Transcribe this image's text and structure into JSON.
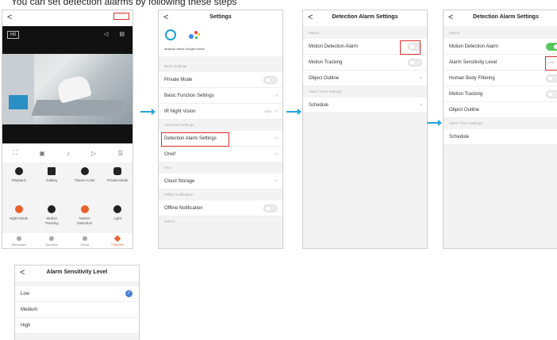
{
  "heading": "You can set detection alarms by following these steps",
  "phone1": {
    "back": "<",
    "more": "···",
    "hd": "HD",
    "features": [
      {
        "label": "Playback",
        "icon": "play-icon"
      },
      {
        "label": "Gallery",
        "icon": "gallery-icon"
      },
      {
        "label": "Theme Color",
        "icon": "palette-icon"
      },
      {
        "label": "Private Mode",
        "icon": "private-mode-icon"
      },
      {
        "label": "Night Mode",
        "icon": "night-mode-icon"
      },
      {
        "label": "Motion Tracking",
        "icon": "motion-tracking-icon"
      },
      {
        "label": "Motion Detection",
        "icon": "motion-detection-icon"
      },
      {
        "label": "Light",
        "icon": "light-icon"
      }
    ],
    "tabs": [
      {
        "label": "Messages",
        "icon": "bell-icon"
      },
      {
        "label": "Direction",
        "icon": "direction-icon"
      },
      {
        "label": "Cloud",
        "icon": "cloud-icon"
      },
      {
        "label": "Features",
        "icon": "features-icon"
      }
    ]
  },
  "phone2": {
    "title": "Settings",
    "brand_amazon": "amazon alexa",
    "brand_google": "Google Home",
    "sections": {
      "basic": "Basic Settings",
      "advanced": "Advanced Settings",
      "vas": "VAS",
      "offline": "Offline Notification",
      "others": "Others"
    },
    "rows": {
      "private_mode": "Private Mode",
      "basic_function": "Basic Function Settings",
      "ir_night": "IR Night Vision",
      "ir_value": "Auto",
      "detection_alarm": "Detection Alarm Settings",
      "onvif": "Onvif",
      "cloud_storage": "Cloud Storage",
      "offline_notification": "Offline Notification"
    }
  },
  "phone3": {
    "title": "Detection Alarm Settings",
    "section_motion": "Motion",
    "section_timer": "Alarm Timer Settings",
    "rows": {
      "motion_alarm": "Motion Detection Alarm",
      "motion_tracking": "Motion Tracking",
      "object_outline": "Object Outline",
      "schedule": "Schedule"
    }
  },
  "phone4": {
    "title": "Detection Alarm Settings",
    "section_motion": "Motion",
    "section_timer": "Alarm Timer Settings",
    "rows": {
      "motion_alarm": "Motion Detection Alarm",
      "sensitivity": "Alarm Sensitivity Level",
      "sensitivity_value": "Low",
      "human_body": "Human Body Filtering",
      "motion_tracking": "Motion Tracking",
      "object_outline": "Object Outline",
      "schedule": "Schedule"
    }
  },
  "phone5": {
    "title": "Alarm Sensitivity Level",
    "options": [
      "Low",
      "Medium",
      "High"
    ]
  },
  "colors": {
    "accent": "#29a3d9",
    "highlight": "#d9302c",
    "toggle_on": "#57c75e",
    "orange": "#e8612c"
  }
}
